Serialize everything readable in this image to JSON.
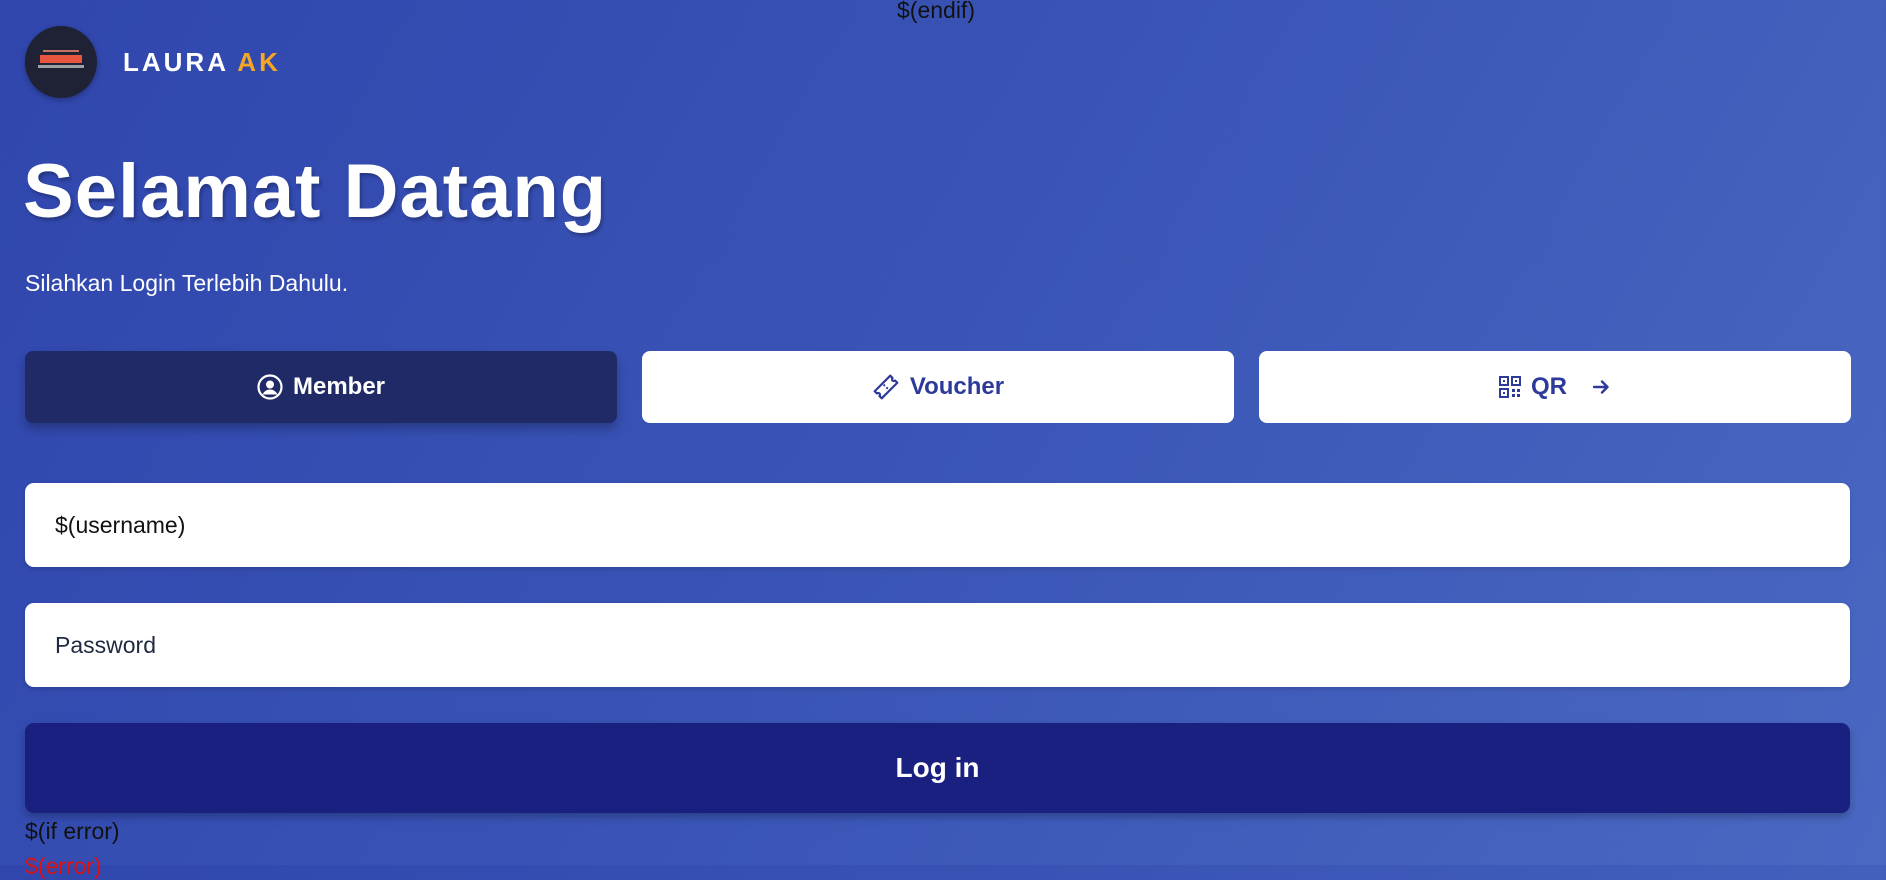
{
  "template_tags": {
    "endif_top": "$(endif)",
    "if_error": "$(if error)",
    "error_value": "$(error)"
  },
  "brand": {
    "name_part1": "LAURA",
    "name_part2": "AK",
    "logo_icon": "hotspot-logo"
  },
  "hero": {
    "title": "Selamat Datang",
    "subtitle": "Silahkan Login Terlebih Dahulu."
  },
  "tabs": [
    {
      "label": "Member",
      "icon": "user-circle-icon",
      "active": true
    },
    {
      "label": "Voucher",
      "icon": "ticket-icon",
      "active": false
    },
    {
      "label": "QR",
      "icon": "qr-code-icon",
      "active": false,
      "trailing_icon": "arrow-right-icon"
    }
  ],
  "form": {
    "username_value": "$(username)",
    "password_placeholder": "Password",
    "login_label": "Log in"
  },
  "colors": {
    "background": "#3a55b6",
    "active_tab": "#1f2a66",
    "login_button": "#1a2080",
    "brand_accent": "#f5a623",
    "tab_text": "#2d3a9a"
  }
}
